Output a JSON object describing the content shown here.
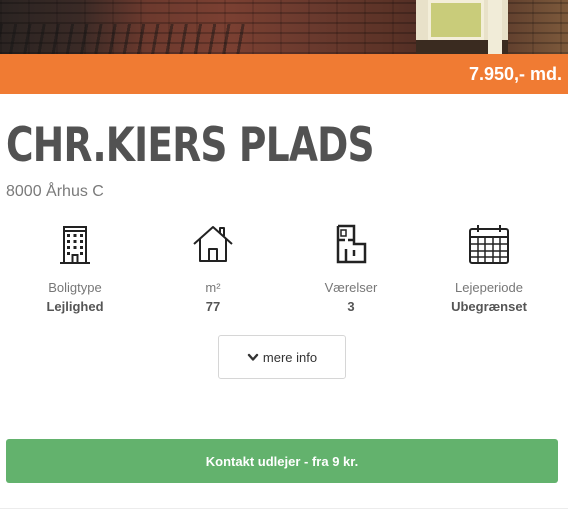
{
  "listing": {
    "price": "7.950,- md.",
    "title": "CHR.KIERS PLADS",
    "address": "8000 Århus C"
  },
  "features": [
    {
      "icon": "apartment-building-icon",
      "label": "Boligtype",
      "value": "Lejlighed"
    },
    {
      "icon": "house-icon",
      "label": "m²",
      "value": "77"
    },
    {
      "icon": "floorplan-icon",
      "label": "Værelser",
      "value": "3"
    },
    {
      "icon": "calendar-icon",
      "label": "Lejeperiode",
      "value": "Ubegrænset"
    }
  ],
  "buttons": {
    "more_info": "mere info",
    "contact": "Kontakt udlejer - fra 9 kr."
  },
  "colors": {
    "price_bar": "#f07b33",
    "contact_button": "#63b26d",
    "title_text": "#525252"
  }
}
